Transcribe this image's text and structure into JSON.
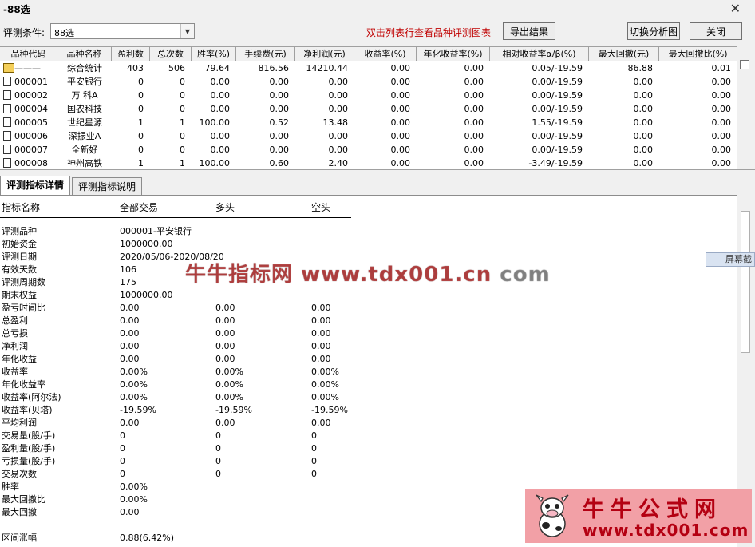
{
  "window": {
    "title": "-88选",
    "close_glyph": "✕"
  },
  "toolbar": {
    "condition_label": "评测条件:",
    "condition_value": "88选",
    "hint": "双击列表行查看品种评测图表",
    "export_label": "导出结果",
    "switch_label": "切换分析图",
    "close_label": "关闭"
  },
  "table": {
    "headers": [
      "品种代码",
      "品种名称",
      "盈利数",
      "总次数",
      "胜率(%)",
      "手续费(元)",
      "净利润(元)",
      "收益率(%)",
      "年化收益率(%)",
      "相对收益率α/β(%)",
      "最大回撤(元)",
      "最大回撤比(%)"
    ],
    "rows": [
      {
        "code": "———",
        "name": "综合统计",
        "win": "403",
        "total": "506",
        "rate": "79.64",
        "fee": "816.56",
        "profit": "14210.44",
        "ret": "0.00",
        "annual": "0.00",
        "rel": "0.05/-19.59",
        "dd": "86.88",
        "ddr": "0.01"
      },
      {
        "code": "000001",
        "name": "平安银行",
        "win": "0",
        "total": "0",
        "rate": "0.00",
        "fee": "0.00",
        "profit": "0.00",
        "ret": "0.00",
        "annual": "0.00",
        "rel": "0.00/-19.59",
        "dd": "0.00",
        "ddr": "0.00"
      },
      {
        "code": "000002",
        "name": "万 科A",
        "win": "0",
        "total": "0",
        "rate": "0.00",
        "fee": "0.00",
        "profit": "0.00",
        "ret": "0.00",
        "annual": "0.00",
        "rel": "0.00/-19.59",
        "dd": "0.00",
        "ddr": "0.00"
      },
      {
        "code": "000004",
        "name": "国农科技",
        "win": "0",
        "total": "0",
        "rate": "0.00",
        "fee": "0.00",
        "profit": "0.00",
        "ret": "0.00",
        "annual": "0.00",
        "rel": "0.00/-19.59",
        "dd": "0.00",
        "ddr": "0.00"
      },
      {
        "code": "000005",
        "name": "世纪星源",
        "win": "1",
        "total": "1",
        "rate": "100.00",
        "fee": "0.52",
        "profit": "13.48",
        "ret": "0.00",
        "annual": "0.00",
        "rel": "1.55/-19.59",
        "dd": "0.00",
        "ddr": "0.00"
      },
      {
        "code": "000006",
        "name": "深振业A",
        "win": "0",
        "total": "0",
        "rate": "0.00",
        "fee": "0.00",
        "profit": "0.00",
        "ret": "0.00",
        "annual": "0.00",
        "rel": "0.00/-19.59",
        "dd": "0.00",
        "ddr": "0.00"
      },
      {
        "code": "000007",
        "name": "全新好",
        "win": "0",
        "total": "0",
        "rate": "0.00",
        "fee": "0.00",
        "profit": "0.00",
        "ret": "0.00",
        "annual": "0.00",
        "rel": "0.00/-19.59",
        "dd": "0.00",
        "ddr": "0.00"
      },
      {
        "code": "000008",
        "name": "神州高铁",
        "win": "1",
        "total": "1",
        "rate": "100.00",
        "fee": "0.60",
        "profit": "2.40",
        "ret": "0.00",
        "annual": "0.00",
        "rel": "-3.49/-19.59",
        "dd": "0.00",
        "ddr": "0.00"
      }
    ]
  },
  "tabs": [
    "评测指标详情",
    "评测指标说明"
  ],
  "detail": {
    "headers": [
      "指标名称",
      "全部交易",
      "多头",
      "空头"
    ],
    "rows": [
      [
        "评测品种",
        "000001-平安银行",
        "",
        ""
      ],
      [
        "初始资金",
        "1000000.00",
        "",
        ""
      ],
      [
        "评测日期",
        "2020/05/06-2020/08/20",
        "",
        ""
      ],
      [
        "有效天数",
        "106",
        "",
        ""
      ],
      [
        "评测周期数",
        "175",
        "",
        ""
      ],
      [
        "期末权益",
        "1000000.00",
        "",
        ""
      ],
      [
        "盈亏时间比",
        "0.00",
        "0.00",
        "0.00"
      ],
      [
        "总盈利",
        "0.00",
        "0.00",
        "0.00"
      ],
      [
        "总亏损",
        "0.00",
        "0.00",
        "0.00"
      ],
      [
        "净利润",
        "0.00",
        "0.00",
        "0.00"
      ],
      [
        "年化收益",
        "0.00",
        "0.00",
        "0.00"
      ],
      [
        "收益率",
        "0.00%",
        "0.00%",
        "0.00%"
      ],
      [
        "年化收益率",
        "0.00%",
        "0.00%",
        "0.00%"
      ],
      [
        "收益率(阿尔法)",
        "0.00%",
        "0.00%",
        "0.00%"
      ],
      [
        "收益率(贝塔)",
        "-19.59%",
        "-19.59%",
        "-19.59%"
      ],
      [
        "平均利润",
        "0.00",
        "0.00",
        "0.00"
      ],
      [
        "交易量(股/手)",
        "0",
        "0",
        "0"
      ],
      [
        "盈利量(股/手)",
        "0",
        "0",
        "0"
      ],
      [
        "亏损量(股/手)",
        "0",
        "0",
        "0"
      ],
      [
        "交易次数",
        "0",
        "0",
        "0"
      ],
      [
        "胜率",
        "0.00%",
        "",
        ""
      ],
      [
        "最大回撤比",
        "0.00%",
        "",
        ""
      ],
      [
        "最大回撤",
        "0.00",
        "",
        ""
      ],
      [
        "",
        "",
        " ",
        ""
      ],
      [
        "区间涨幅",
        "0.88(6.42%)",
        "",
        ""
      ]
    ]
  },
  "watermark": {
    "cn": "牛牛指标网",
    "url": "www.tdx001.cn",
    "gray": "com"
  },
  "side_tab": "屏幕截",
  "logo": {
    "title": "牛牛公式网",
    "url": "www.tdx001.com"
  }
}
